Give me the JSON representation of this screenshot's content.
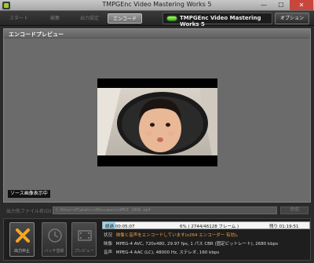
{
  "window": {
    "title": "TMPGEnc Video Mastering Works 5",
    "controls": {
      "minimize": "—",
      "maximize": "☐",
      "close": "✕"
    }
  },
  "tabs": [
    {
      "label": "スタート",
      "active": false
    },
    {
      "label": "編集",
      "active": false
    },
    {
      "label": "出力設定",
      "active": false
    },
    {
      "label": "エンコード",
      "active": true
    }
  ],
  "brand": "TMPGEnc Video Mastering Works 5",
  "options_label": "オプション",
  "panel": {
    "title": "エンコードプレビュー",
    "source_badge": "ソース画像表示中"
  },
  "output": {
    "label": "出力先ファイル名(O)",
    "path": "C:¥Users¥Takahiro¥Documents¥MVI_2868.mp4",
    "browse_label": "参照"
  },
  "buttons": {
    "stop": "出力中止",
    "batch": "バッチ登録",
    "preview": "プレビュー"
  },
  "status": {
    "progress_fraction": 0.06,
    "elapsed": "経過 00:05:07",
    "frames": "6% ( 2744/46128 フレーム )",
    "remaining": "残り 01:19:51",
    "rows": [
      {
        "key": "状況",
        "value": "映像と音声をエンコードしています(x264 エンコーダー 有効)。",
        "highlight": true
      },
      {
        "key": "映像",
        "value": "MPEG-4 AVC, 720x480, 29.97 fps, 1 パス CBR (固定ビットレート), 2680 kbps",
        "highlight": false
      },
      {
        "key": "音声",
        "value": "MPEG-4 AAC (LC), 48000 Hz, ステレオ, 160 kbps",
        "highlight": false
      }
    ]
  },
  "colors": {
    "accent_led": "#3fb81c",
    "stop_icon": "#f5a623",
    "progress_fill": "#9bd6f0",
    "status_highlight": "#f0a040"
  }
}
